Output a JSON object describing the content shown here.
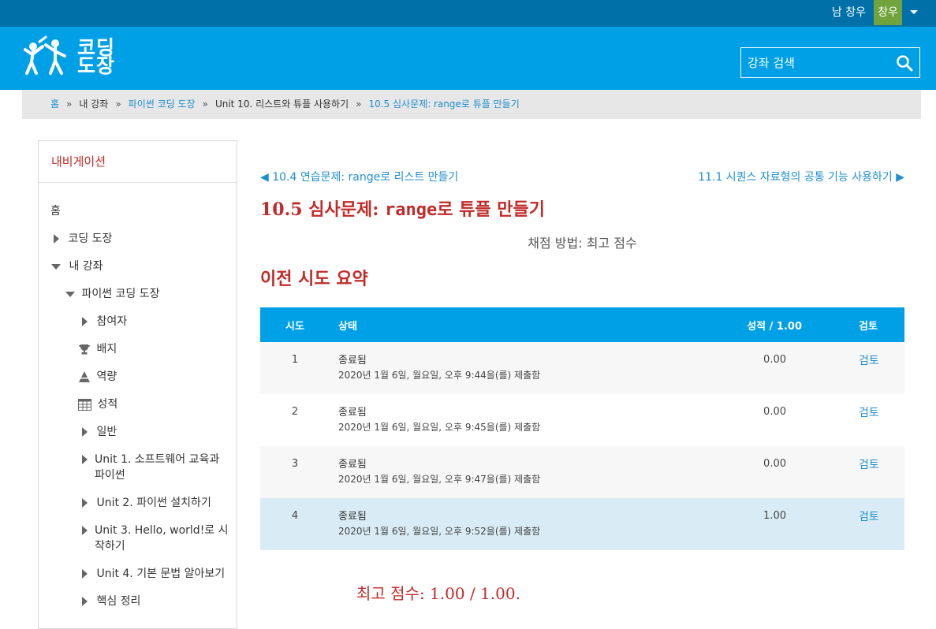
{
  "topbar": {
    "user_name": "남 창우",
    "avatar_text": "창우"
  },
  "brand": {
    "logo_text_line1": "코딩",
    "logo_text_line2": "도장"
  },
  "search": {
    "placeholder": "강좌 검색"
  },
  "breadcrumb": [
    {
      "label": "홈",
      "link": true
    },
    {
      "label": "내 강좌",
      "link": false
    },
    {
      "label": "파이썬 코딩 도장",
      "link": true
    },
    {
      "label": "Unit 10. 리스트와 튜플 사용하기",
      "link": false
    },
    {
      "label": "10.5 심사문제: range로 튜플 만들기",
      "link": true
    }
  ],
  "navigation": {
    "title": "내비게이션",
    "home": "홈",
    "coding_dojang": "코딩 도장",
    "my_courses": "내 강좌",
    "python_course": "파이썬 코딩 도장",
    "participants": "참여자",
    "badges": "배지",
    "competencies": "역량",
    "grades": "성적",
    "general": "일반",
    "unit1_line1": "Unit 1. 소프트웨어 교육과",
    "unit1_line2": "파이썬",
    "unit2": "Unit 2. 파이썬 설치하기",
    "unit3_line1": "Unit 3. Hello, world!로 시",
    "unit3_line2": "작하기",
    "unit4": "Unit 4. 기본 문법 알아보기",
    "summary": "핵심 정리"
  },
  "page": {
    "prev_link": "◀ 10.4 연습문제: range로 리스트 만들기",
    "next_link": "11.1 시퀀스 자료형의 공통 기능 사용하기 ▶",
    "title_prefix": "10.5 심사문제: ",
    "title_code": "range",
    "title_suffix": "로 튜플 만들기",
    "grading_method": "채점 방법: 최고 점수",
    "summary_title": "이전 시도 요약",
    "best_score": "최고 점수: 1.00 / 1.00."
  },
  "attempts_table": {
    "headers": {
      "attempt": "시도",
      "state": "상태",
      "grade": "성적 / 1.00",
      "review": "검토"
    },
    "rows": [
      {
        "attempt": "1",
        "state": "종료됨",
        "submitted": "2020년 1월 6일, 월요일, 오후 9:44을(를) 제출함",
        "grade": "0.00",
        "review": "검토"
      },
      {
        "attempt": "2",
        "state": "종료됨",
        "submitted": "2020년 1월 6일, 월요일, 오후 9:45을(를) 제출함",
        "grade": "0.00",
        "review": "검토"
      },
      {
        "attempt": "3",
        "state": "종료됨",
        "submitted": "2020년 1월 6일, 월요일, 오후 9:47을(를) 제출함",
        "grade": "0.00",
        "review": "검토"
      },
      {
        "attempt": "4",
        "state": "종료됨",
        "submitted": "2020년 1월 6일, 월요일, 오후 9:52을(를) 제출함",
        "grade": "1.00",
        "review": "검토"
      }
    ]
  },
  "colors": {
    "topbar": "#0071a8",
    "header": "#00a0e6",
    "accent_red": "#c22a28",
    "link": "#1f8fcf",
    "avatar": "#71a33d"
  }
}
